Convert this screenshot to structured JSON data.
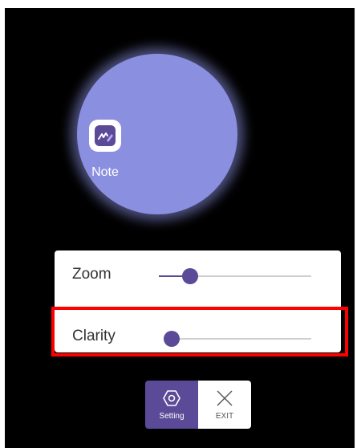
{
  "magnifier": {
    "app_label": "Note",
    "icon": "note-app-icon"
  },
  "controls": {
    "zoom": {
      "label": "Zoom",
      "level": 0.15
    },
    "clarity": {
      "label": "Clarity",
      "level": 0.0
    }
  },
  "toolbar": {
    "setting_label": "Setting",
    "setting_icon": "hexagon-settings-icon",
    "exit_label": "EXIT",
    "exit_icon": "close-icon"
  },
  "colors": {
    "accent": "#5a4a97",
    "lens": "#8b8fe0",
    "highlight": "#ff0000"
  }
}
